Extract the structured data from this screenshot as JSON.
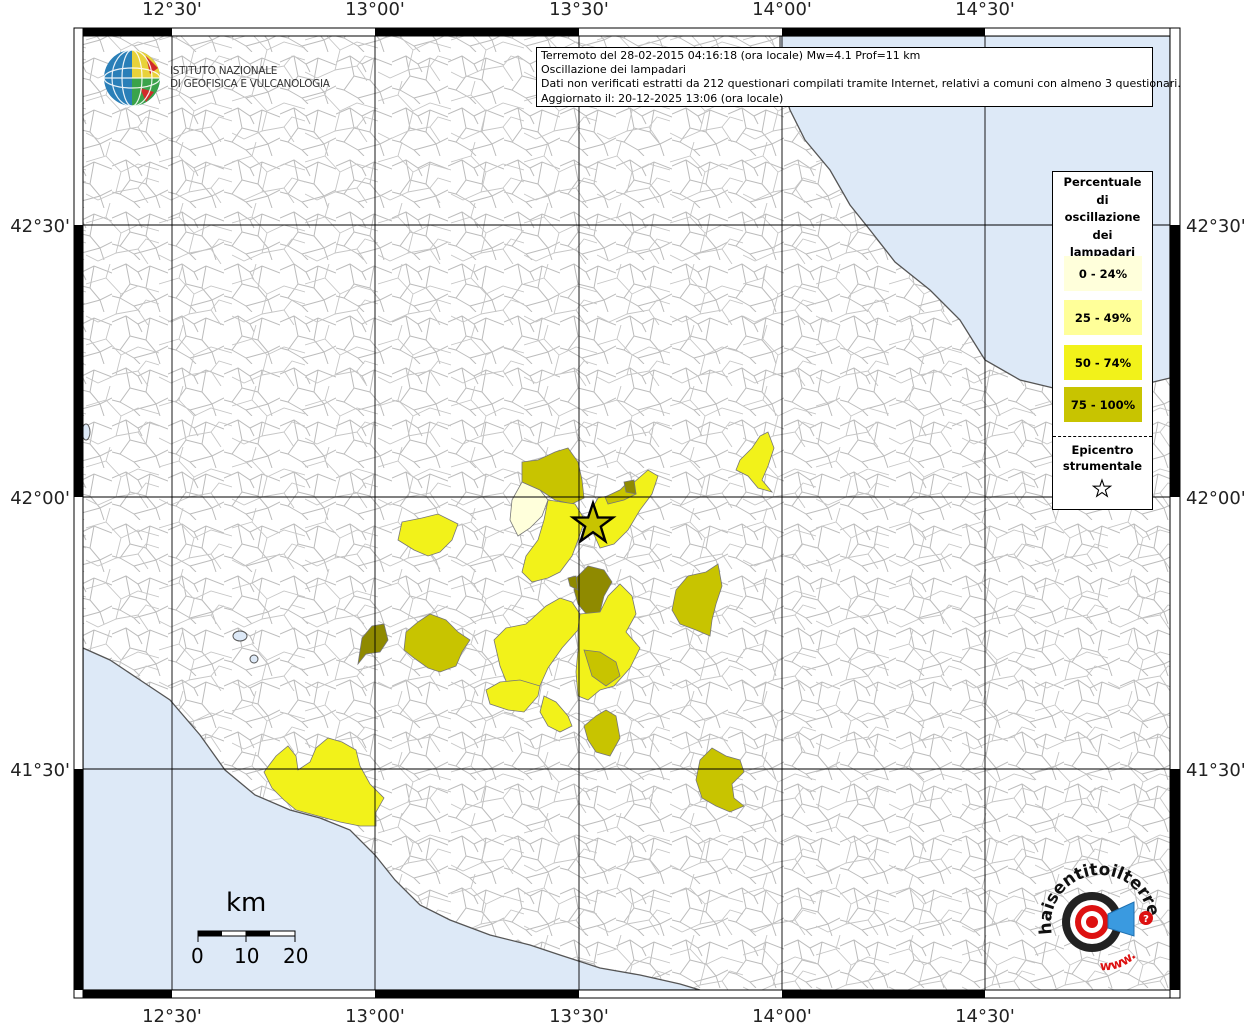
{
  "map": {
    "lon_labels": [
      "12°30'",
      "13°00'",
      "13°30'",
      "14°00'",
      "14°30'"
    ],
    "lat_labels": [
      "42°30'",
      "42°00'",
      "41°30'"
    ],
    "colors": {
      "sea": "#dde9f7",
      "coast": "#555555",
      "border": "#bcbcbc",
      "grid": "#000000",
      "class_0_24": "#ffffdb",
      "class_25_49": "#ffff99",
      "class_50_74": "#f2f21a",
      "class_75_100": "#c8c400",
      "dark": "#8f8a00"
    }
  },
  "header": {
    "line1": "Terremoto del 28-02-2015 04:16:18 (ora locale) Mw=4.1 Prof=11 km",
    "line2": "Oscillazione dei lampadari",
    "line3": "Dati non verificati estratti da 212 questionari compilati tramite Internet, relativi a comuni con almeno 3 questionari.",
    "line4": "Aggiornato il: 20-12-2025 13:06 (ora locale)"
  },
  "institute": {
    "line1": "ISTITUTO NAZIONALE",
    "line2": "DI GEOFISICA E VULCANOLOGIA"
  },
  "legend": {
    "title": "Percentuale\ndi\noscillazione\ndei\nlampadari",
    "items": [
      {
        "label": "0 - 24%",
        "color": "#ffffdb"
      },
      {
        "label": "25 - 49%",
        "color": "#ffff99"
      },
      {
        "label": "50 - 74%",
        "color": "#f2f21a"
      },
      {
        "label": "75 - 100%",
        "color": "#c8c400"
      }
    ],
    "epicenter_label": "Epicentro\nstrumentale",
    "epicenter_icon": "star-icon"
  },
  "scale": {
    "unit": "km",
    "ticks": [
      "0",
      "10",
      "20"
    ]
  },
  "badge": {
    "text_top": "haisentitoilterremoto.it",
    "text_bottom": "www.",
    "icon": "target-megaphone-icon"
  }
}
